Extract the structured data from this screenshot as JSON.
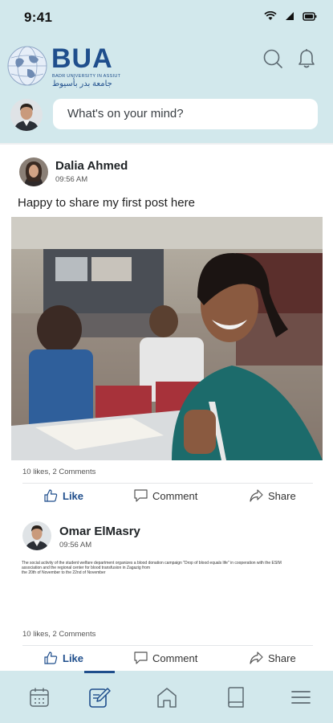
{
  "status": {
    "time": "9:41"
  },
  "header": {
    "logo_title": "BUA",
    "logo_subtitle": "BADR UNIVERSITY IN ASSIUT",
    "logo_arabic": "جامعة بدر بأسيوط"
  },
  "composer": {
    "placeholder": "What's on your mind?"
  },
  "posts": [
    {
      "author": "Dalia Ahmed",
      "time": "09:56 AM",
      "text": "Happy to share my first post here",
      "stats": "10 likes, 2 Comments",
      "actions": {
        "like": "Like",
        "comment": "Comment",
        "share": "Share"
      }
    },
    {
      "author": "Omar ElMasry",
      "time": "09:56 AM",
      "text_lines": [
        "The social activity of the student welfare department organizes a blood donation campaign \"Drop of blood equals life\" in cooperation with the ESIM",
        "association and the regional center for blood transfusion in Zagazig from",
        "the 20th of November to the 22nd of November"
      ],
      "stats": "10 likes, 2 Comments",
      "actions": {
        "like": "Like",
        "comment": "Comment",
        "share": "Share"
      }
    }
  ],
  "bottom_nav": {
    "items": [
      "calendar-icon",
      "edit-note-icon",
      "home-icon",
      "book-icon",
      "menu-icon"
    ],
    "active_index": 1
  },
  "colors": {
    "brand": "#1f4e8c",
    "header_bg": "#d2e8ec",
    "feed_bg": "#ffffff"
  }
}
